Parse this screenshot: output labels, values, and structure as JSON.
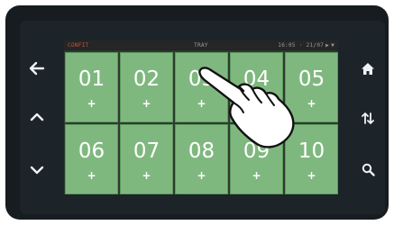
{
  "status_bar": {
    "left": "CONFIT",
    "center": "TRAY",
    "right": "16:05 · 21/07"
  },
  "tiles": [
    {
      "number": "01",
      "action": "+"
    },
    {
      "number": "02",
      "action": "+"
    },
    {
      "number": "03",
      "action": "+"
    },
    {
      "number": "04",
      "action": "+"
    },
    {
      "number": "05",
      "action": "+"
    },
    {
      "number": "06",
      "action": "+"
    },
    {
      "number": "07",
      "action": "+"
    },
    {
      "number": "08",
      "action": "+"
    },
    {
      "number": "09",
      "action": "+"
    },
    {
      "number": "10",
      "action": "+"
    }
  ],
  "left_nav": [
    "back-arrow-icon",
    "chevron-up-icon",
    "chevron-down-icon"
  ],
  "right_nav": [
    "home-icon",
    "sort-arrows-icon",
    "search-icon"
  ],
  "colors": {
    "tile": "#7fb87f",
    "tile_border": "#5e9a5e",
    "screen": "#1c2329",
    "bezel": "#161c20"
  }
}
